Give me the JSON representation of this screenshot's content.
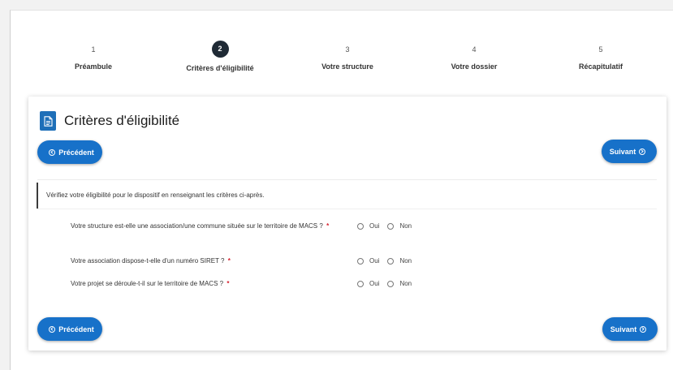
{
  "stepper": {
    "steps": [
      {
        "number": "1",
        "label": "Préambule",
        "active": false
      },
      {
        "number": "2",
        "label": "Critères d'éligibilité",
        "active": true
      },
      {
        "number": "3",
        "label": "Votre structure",
        "active": false
      },
      {
        "number": "4",
        "label": "Votre dossier",
        "active": false
      },
      {
        "number": "5",
        "label": "Récapitulatif",
        "active": false
      }
    ]
  },
  "card": {
    "title": "Critères d'éligibilité",
    "icon": "document-icon",
    "prev_label": "Précédent",
    "next_label": "Suivant",
    "intro": "Vérifiez votre éligibilité pour le dispositif en renseignant les critères ci-après.",
    "required_mark": "*",
    "questions": [
      {
        "text": "Votre structure est-elle une association/une commune située sur le territoire de MACS ?",
        "option_yes": "Oui",
        "option_no": "Non"
      },
      {
        "text": "Votre association dispose-t-elle d'un numéro SIRET ?",
        "option_yes": "Oui",
        "option_no": "Non"
      },
      {
        "text": "Votre projet se déroule-t-il sur le territoire de MACS ?",
        "option_yes": "Oui",
        "option_no": "Non"
      }
    ]
  },
  "colors": {
    "accent": "#1771c9",
    "step_active": "#1f2a35",
    "required": "#d6202e"
  }
}
